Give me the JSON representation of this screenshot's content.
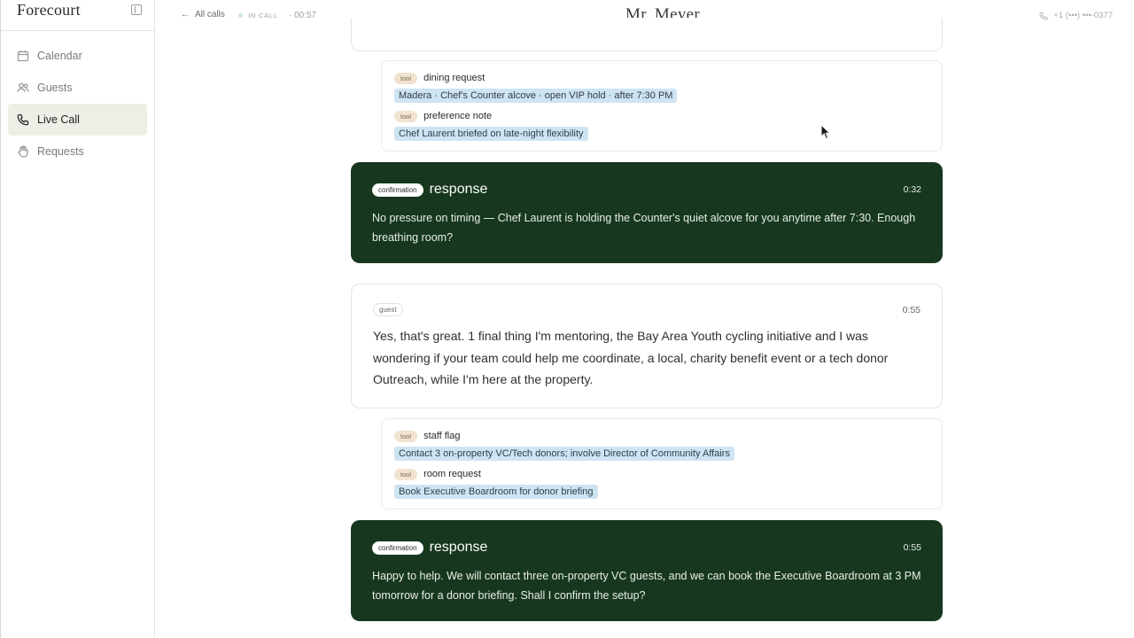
{
  "sidebar": {
    "brand": "Forecourt",
    "items": [
      {
        "label": "Calendar",
        "icon": "calendar-icon",
        "active": false
      },
      {
        "label": "Guests",
        "icon": "users-icon",
        "active": false
      },
      {
        "label": "Live Call",
        "icon": "phone-icon",
        "active": true
      },
      {
        "label": "Requests",
        "icon": "hand-icon",
        "active": false
      }
    ]
  },
  "header": {
    "back_label": "All calls",
    "status_label": "IN CALL",
    "timer": "00:57",
    "title": "Mr. Meyer",
    "phone": "+1 (•••) •••-0377"
  },
  "feed": {
    "tool_group_1": [
      {
        "badge": "tool",
        "name": "dining request",
        "chip": "Madera · Chef's Counter alcove · open VIP hold · after 7:30 PM"
      },
      {
        "badge": "tool",
        "name": "preference note",
        "chip": "Chef Laurent briefed on late-night flexibility"
      }
    ],
    "response_1": {
      "badge": "confirmation",
      "title": "response",
      "time": "0:32",
      "text": "No pressure on timing — Chef Laurent is holding the Counter's quiet alcove for you anytime after 7:30. Enough breathing room?"
    },
    "guest_1": {
      "badge": "guest",
      "time": "0:55",
      "text": "Yes, that's great. 1 final thing I'm mentoring, the Bay Area Youth cycling initiative and I was wondering if your team could help me coordinate, a local, charity benefit event or a tech donor Outreach, while I'm here at the property."
    },
    "tool_group_2": [
      {
        "badge": "tool",
        "name": "staff flag",
        "chip": "Contact 3 on-property VC/Tech donors; involve Director of Community Affairs"
      },
      {
        "badge": "tool",
        "name": "room request",
        "chip": "Book Executive Boardroom for donor briefing"
      }
    ],
    "response_2": {
      "badge": "confirmation",
      "title": "response",
      "time": "0:55",
      "text": "Happy to help. We will contact three on-property VC guests, and we can book the Executive Boardroom at 3 PM tomorrow for a donor briefing. Shall I confirm the setup?"
    }
  },
  "colors": {
    "response_bg": "#17381f",
    "chip_bg": "#cfe4f3",
    "tool_badge_bg": "#f1e3cf",
    "active_nav_bg": "#eeede6"
  }
}
